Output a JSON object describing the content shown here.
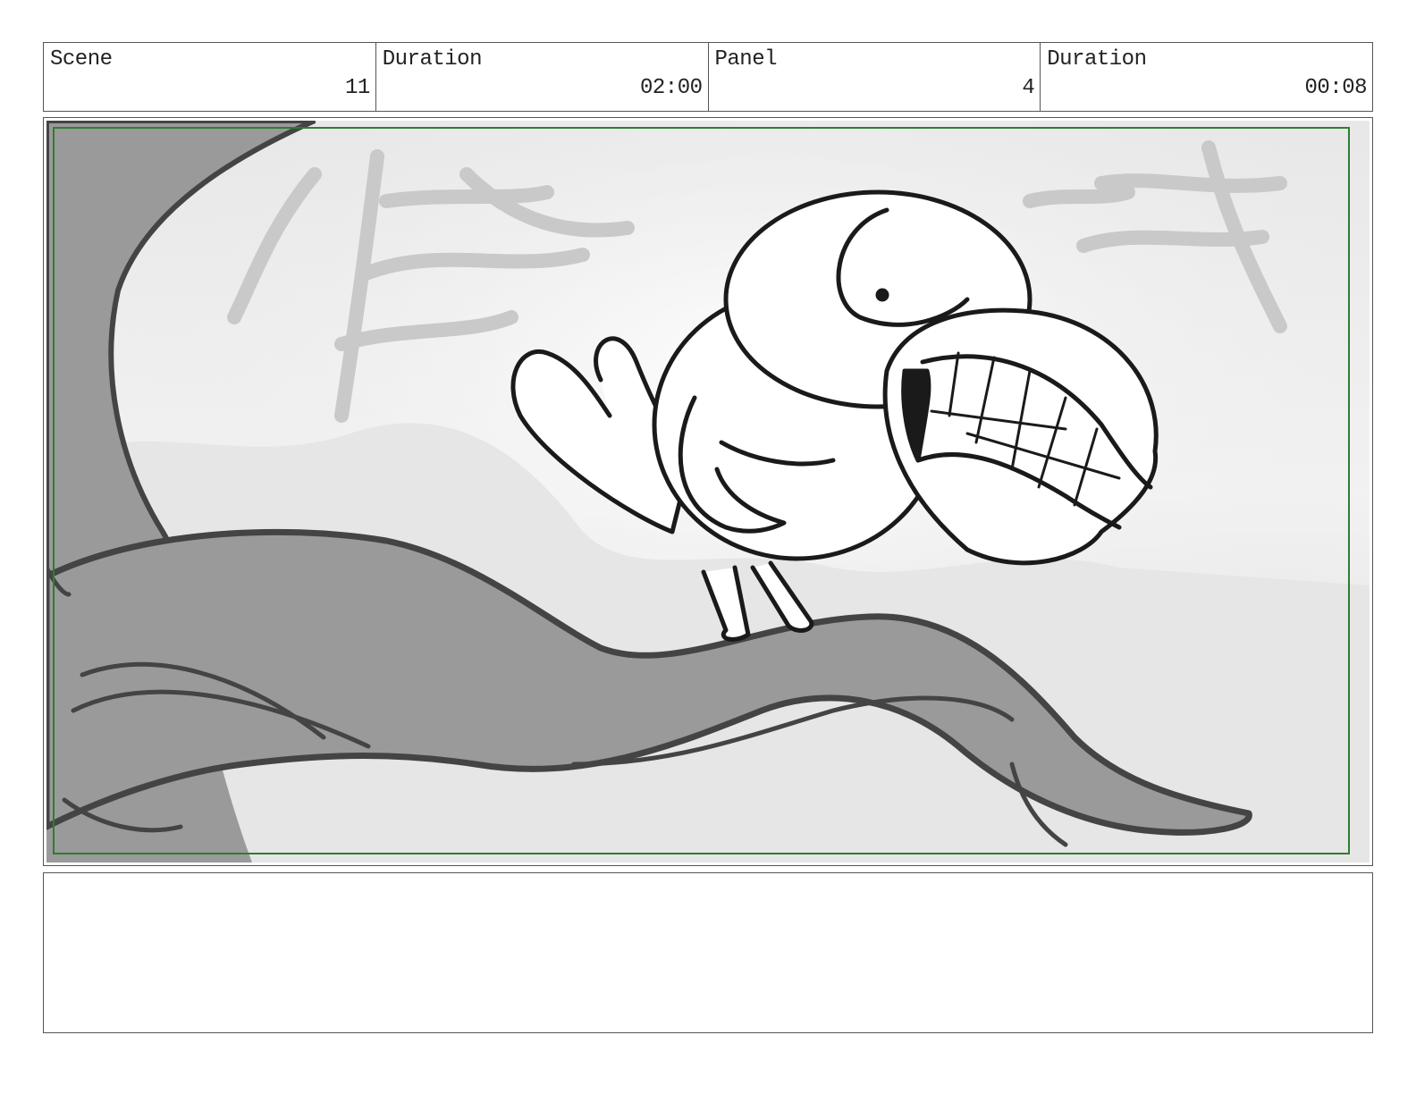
{
  "header": {
    "fields": [
      {
        "label": "Scene",
        "value": "11"
      },
      {
        "label": "Duration",
        "value": "02:00"
      },
      {
        "label": "Panel",
        "value": "4"
      },
      {
        "label": "Duration",
        "value": "00:08"
      }
    ]
  },
  "notes": {
    "text": ""
  },
  "colors": {
    "safe_frame": "#2e7d32",
    "branch": "#9a9a9a",
    "line": "#222222"
  }
}
